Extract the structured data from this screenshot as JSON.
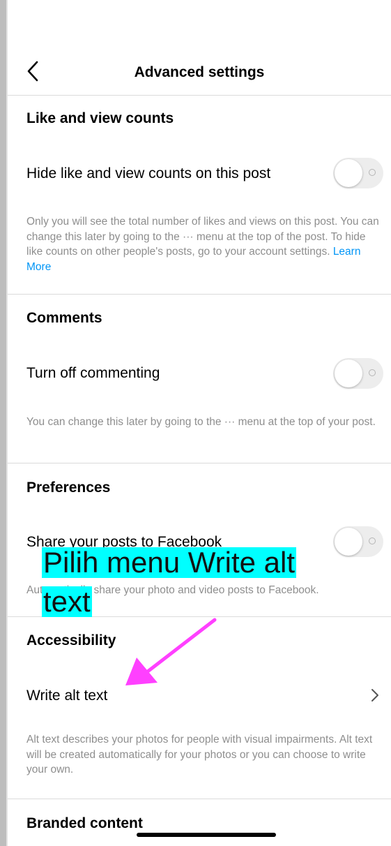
{
  "header": {
    "title": "Advanced settings",
    "back_icon": "chevron-left-icon"
  },
  "like_counts": {
    "section_title": "Like and view counts",
    "row_label": "Hide like and view counts on this post",
    "toggle_on": false,
    "description": "Only you will see the total number of likes and views on this post. You can change this later by going to the ··· menu at the top of the post. To hide like counts on other people's posts, go to your account settings.",
    "learn_more": "Learn More"
  },
  "comments": {
    "section_title": "Comments",
    "row_label": "Turn off commenting",
    "toggle_on": false,
    "description": "You can change this later by going to the ··· menu at the top of your post."
  },
  "preferences": {
    "section_title": "Preferences",
    "row_label": "Share your posts to Facebook",
    "toggle_on": false,
    "description": "Automatically share your photo and video posts to Facebook."
  },
  "accessibility": {
    "section_title": "Accessibility",
    "row_label": "Write alt text",
    "chevron_icon": "chevron-right-icon",
    "description": "Alt text describes your photos for people with visual impairments. Alt text will be created automatically for your photos or you can choose to write your own."
  },
  "branded": {
    "section_title": "Branded content"
  },
  "annotation": {
    "line1": "Pilih menu Write alt",
    "line2": "text",
    "highlight_color": "#00ffff",
    "arrow_color": "#ff40ff"
  }
}
